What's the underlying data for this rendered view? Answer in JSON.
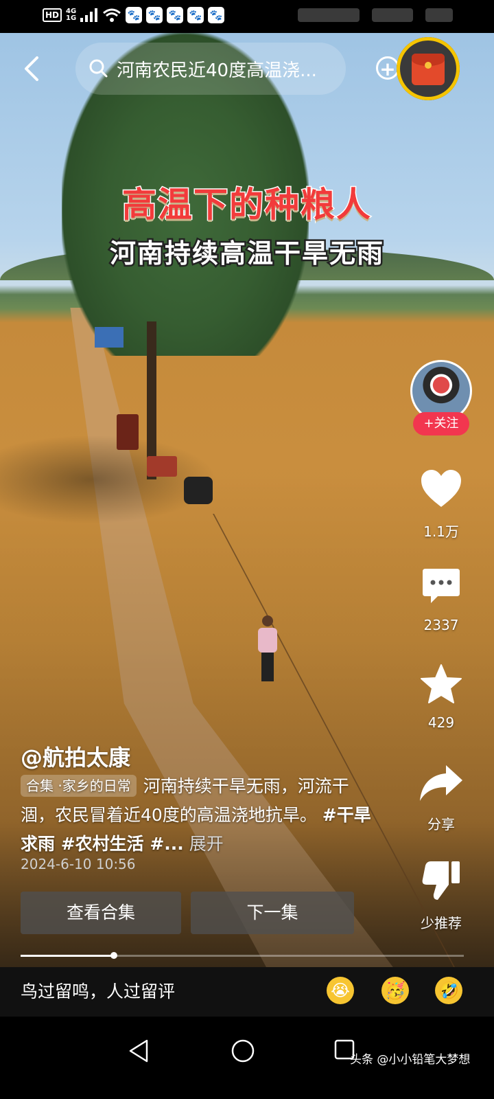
{
  "status_bar": {
    "hd": "HD",
    "network": "4G",
    "network_sub": "1G",
    "app_icons": [
      "paw-icon",
      "paw-icon",
      "paw-icon",
      "paw-icon",
      "paw-icon"
    ]
  },
  "top_bar": {
    "search_query": "河南农民近40度高温浇...",
    "back_icon": "chevron-left-icon",
    "add_icon": "plus-circle-icon",
    "red_packet_icon": "red-envelope-icon"
  },
  "video": {
    "title": "高温下的种粮人",
    "subtitle": "河南持续高温干旱无雨"
  },
  "right_rail": {
    "follow_label": "+关注",
    "like_count": "1.1万",
    "comment_count": "2337",
    "favorite_count": "429",
    "share_label": "分享",
    "dislike_label": "少推荐"
  },
  "post": {
    "author": "@航拍太康",
    "collection_tag": "合集 ·家乡的日常",
    "description": "河南持续干旱无雨，河流干涸，农民冒着近40度的高温浇地抗旱。",
    "hashtags": "#干旱求雨 #农村生活 #...",
    "expand_label": "展开",
    "date": "2024-6-10 10:56",
    "view_collection_label": "查看合集",
    "next_episode_label": "下一集",
    "progress": 0.21
  },
  "comment_bar": {
    "placeholder": "鸟过留鸣，人过留评",
    "emojis": [
      "😭",
      "🥳",
      "🤣"
    ]
  },
  "watermark": "头条 @小小铅笔大梦想",
  "colors": {
    "follow_red": "#f2364f",
    "ring_yellow": "#f5c400",
    "title_red": "#f23b3b"
  }
}
